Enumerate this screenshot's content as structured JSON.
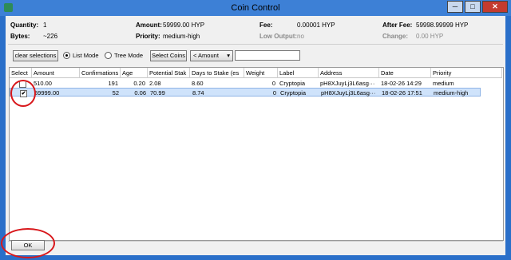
{
  "window": {
    "title": "Coin Control",
    "minimize": "─",
    "maximize": "□",
    "close": "✕"
  },
  "summary": {
    "quantity_label": "Quantity:",
    "quantity_value": "1",
    "amount_label": "Amount:",
    "amount_value": "59999.00 HYP",
    "fee_label": "Fee:",
    "fee_value": "0.00001 HYP",
    "after_fee_label": "After Fee:",
    "after_fee_value": "59998.99999 HYP",
    "bytes_label": "Bytes:",
    "bytes_value": "~226",
    "priority_label": "Priority:",
    "priority_value": "medium-high",
    "low_output_label": "Low Output:",
    "low_output_value": "no",
    "change_label": "Change:",
    "change_value": "0.00 HYP"
  },
  "toolbar": {
    "clear_selections": "clear selections",
    "list_mode": "List Mode",
    "tree_mode": "Tree Mode",
    "select_coins": "Select Coins",
    "sort_value": "< Amount",
    "sort_arrow": "▾",
    "filter_value": ""
  },
  "table": {
    "columns": [
      "Select",
      "Amount",
      "Confirmations",
      "Age",
      "Potential Stak",
      "Days to Stake (es",
      "Weight",
      "Label",
      "Address",
      "Date",
      "Priority"
    ],
    "rows": [
      {
        "checked": false,
        "amount": "510.00",
        "confirmations": "191",
        "age": "0.20",
        "potential_stake": "2.08",
        "days_to_stake": "8.60",
        "weight": "0",
        "label": "Cryptopia",
        "address": "pH8XJuyLj3L6asg···",
        "date": "18-02-26 14:29",
        "priority": "medium"
      },
      {
        "checked": true,
        "amount": "59999.00",
        "confirmations": "52",
        "age": "0.06",
        "potential_stake": "70.99",
        "days_to_stake": "8.74",
        "weight": "0",
        "label": "Cryptopia",
        "address": "pH8XJuyLj3L6asg···",
        "date": "18-02-26 17:51",
        "priority": "medium-high"
      }
    ]
  },
  "footer": {
    "ok": "OK"
  },
  "colors": {
    "annotation_red": "#d8171b",
    "selection_blue": "#cfe3fb",
    "window_blue": "#2a6fc9"
  }
}
